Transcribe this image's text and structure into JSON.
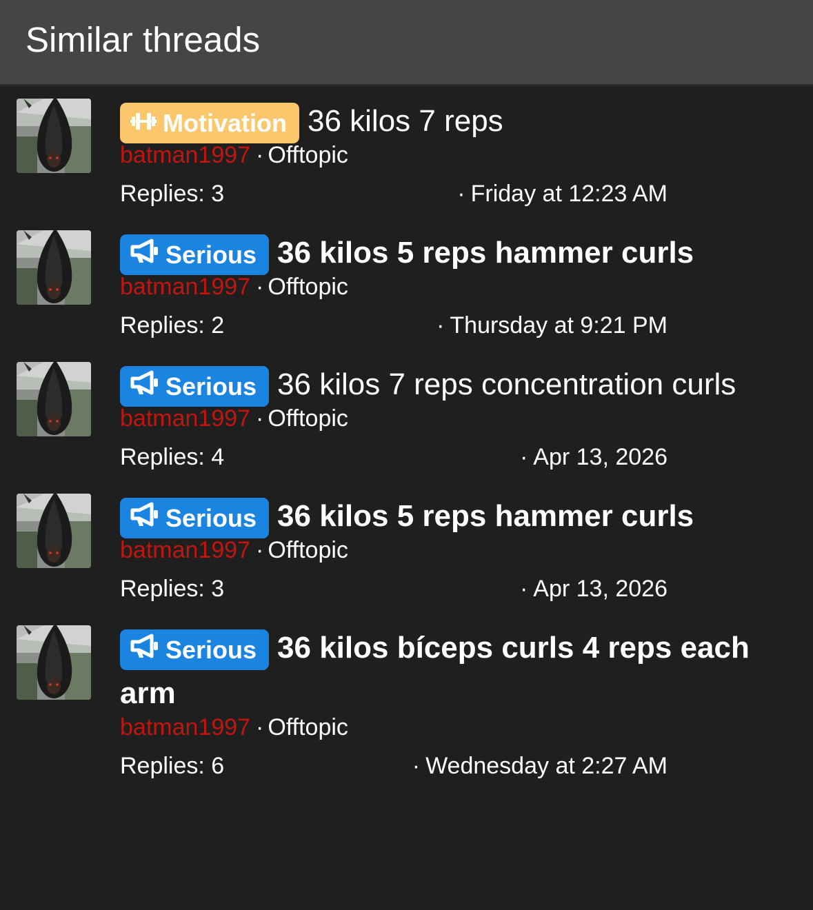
{
  "header": {
    "title": "Similar threads"
  },
  "colors": {
    "motivation_badge": "#fbc76c",
    "serious_badge": "#1a84e0",
    "author": "#c0160f",
    "header_bg": "#454545",
    "page_bg": "#1f1f1f"
  },
  "threads": [
    {
      "badge": {
        "label": "Motivation",
        "icon": "dumbbell-icon",
        "kind": "motivation"
      },
      "title": "36 kilos 7 reps",
      "bold": false,
      "author": "batman1997",
      "separator": "·",
      "forum": "Offtopic",
      "replies": "Replies: 3",
      "date": "Friday at 12:23 AM"
    },
    {
      "badge": {
        "label": "Serious",
        "icon": "megaphone-icon",
        "kind": "serious"
      },
      "title": "36 kilos 5 reps hammer curls",
      "bold": true,
      "author": "batman1997",
      "separator": "·",
      "forum": "Offtopic",
      "replies": "Replies: 2",
      "date": "Thursday at 9:21 PM"
    },
    {
      "badge": {
        "label": "Serious",
        "icon": "megaphone-icon",
        "kind": "serious"
      },
      "title": "36 kilos 7 reps concentration curls",
      "bold": false,
      "author": "batman1997",
      "separator": "·",
      "forum": "Offtopic",
      "replies": "Replies: 4",
      "date": "Apr 13, 2026"
    },
    {
      "badge": {
        "label": "Serious",
        "icon": "megaphone-icon",
        "kind": "serious"
      },
      "title": "36 kilos 5 reps hammer curls",
      "bold": true,
      "author": "batman1997",
      "separator": "·",
      "forum": "Offtopic",
      "replies": "Replies: 3",
      "date": "Apr 13, 2026"
    },
    {
      "badge": {
        "label": "Serious",
        "icon": "megaphone-icon",
        "kind": "serious"
      },
      "title": "36 kilos bíceps curls 4 reps each arm",
      "bold": true,
      "author": "batman1997",
      "separator": "·",
      "forum": "Offtopic",
      "replies": "Replies: 6",
      "date": "Wednesday at 2:27 AM"
    }
  ]
}
